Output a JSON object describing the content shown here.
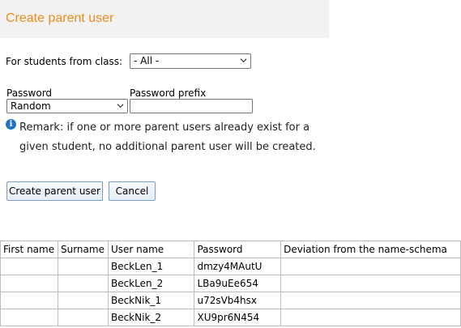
{
  "page": {
    "title": "Create parent user"
  },
  "form": {
    "class_label": "For students from class:",
    "class_select_value": "- All -",
    "password_label": "Password",
    "password_select_value": "Random",
    "prefix_label": "Password prefix",
    "prefix_value": "",
    "remark_text": "Remark: if one or more parent users already exist for a given student, no additional parent user will be created."
  },
  "buttons": {
    "create_label": "Create parent user",
    "cancel_label": "Cancel"
  },
  "table": {
    "headers": [
      "First name",
      "Surname",
      "User name",
      "Password",
      "Deviation from the name-schema"
    ],
    "rows": [
      {
        "first_name": "",
        "surname": "",
        "user_name": "BeckLen_1",
        "password": "dmzy4MAutU",
        "deviation": ""
      },
      {
        "first_name": "",
        "surname": "",
        "user_name": "BeckLen_2",
        "password": "LBa9uEe654",
        "deviation": ""
      },
      {
        "first_name": "",
        "surname": "",
        "user_name": "BeckNik_1",
        "password": "u72sVb4hsx",
        "deviation": ""
      },
      {
        "first_name": "",
        "surname": "",
        "user_name": "BeckNik_2",
        "password": "XU9pr6N454",
        "deviation": ""
      }
    ]
  },
  "colors": {
    "title": "#f08c1c",
    "title_bar_bg": "#f2f2f2",
    "info_icon": "#1f73c4",
    "button_border": "#7a9cc0"
  },
  "icons": {
    "info": "info-icon",
    "dropdown": "chevron-down-icon"
  }
}
